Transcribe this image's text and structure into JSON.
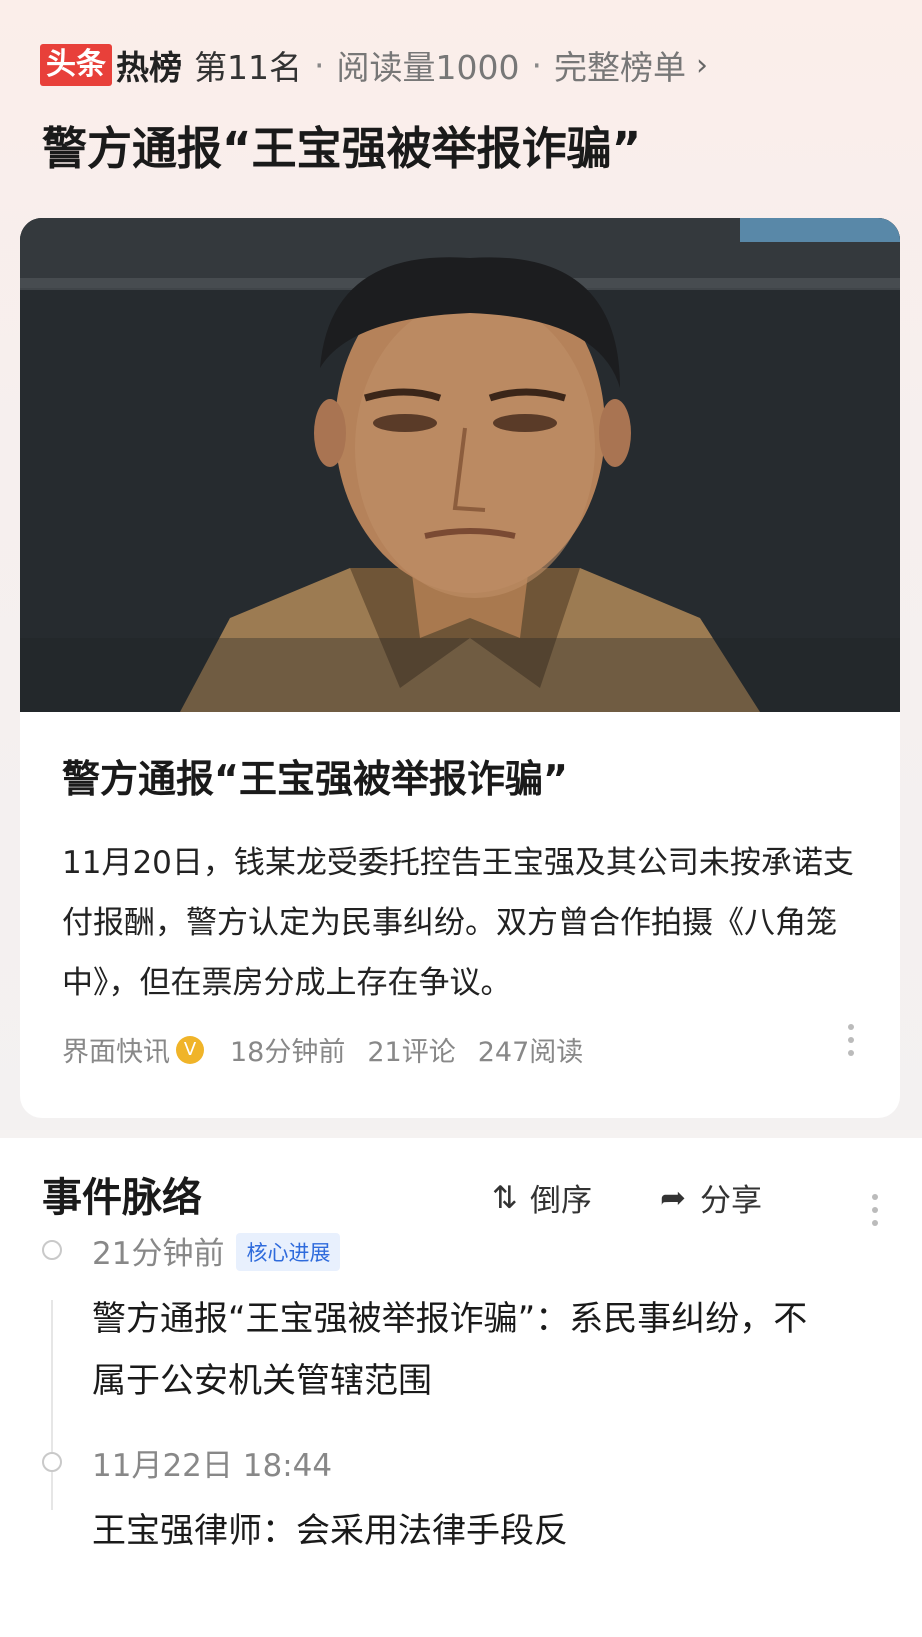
{
  "header": {
    "logo_toutiao": "头条",
    "logo_rebang": "热榜",
    "rank": "第11名",
    "separator": "·",
    "read_count": "阅读量1000",
    "full_list": "完整榜单",
    "chevron": "›",
    "title": "警方通报“王宝强被举报诈骗”"
  },
  "card": {
    "image_icon": "news-photo",
    "title": "警方通报“王宝强被举报诈骗”",
    "summary": "11月20日，钱某龙受委托控告王宝强及其公司未按承诺支付报酬，警方认定为民事纠纷。双方曾合作拍摄《八角笼中》，但在票房分成上存在争议。",
    "source": "界面快讯",
    "verify_icon": "V",
    "time": "18分钟前",
    "comments": "21评论",
    "reads": "247阅读"
  },
  "timeline": {
    "title": "事件脉络",
    "sort_icon": "⇅",
    "sort_label": "倒序",
    "share_icon": "➦",
    "share_label": "分享",
    "items": [
      {
        "time": "21分钟前",
        "badge": "核心进展",
        "text": "警方通报“王宝强被举报诈骗”：系民事纠纷，不属于公安机关管辖范围"
      },
      {
        "time": "11月22日 18:44",
        "text": "王宝强律师：会采用法律手段反"
      }
    ]
  },
  "colors": {
    "brand_red": "#e8403a",
    "badge_blue": "#2f6bdc",
    "verify_gold": "#f0b429"
  }
}
